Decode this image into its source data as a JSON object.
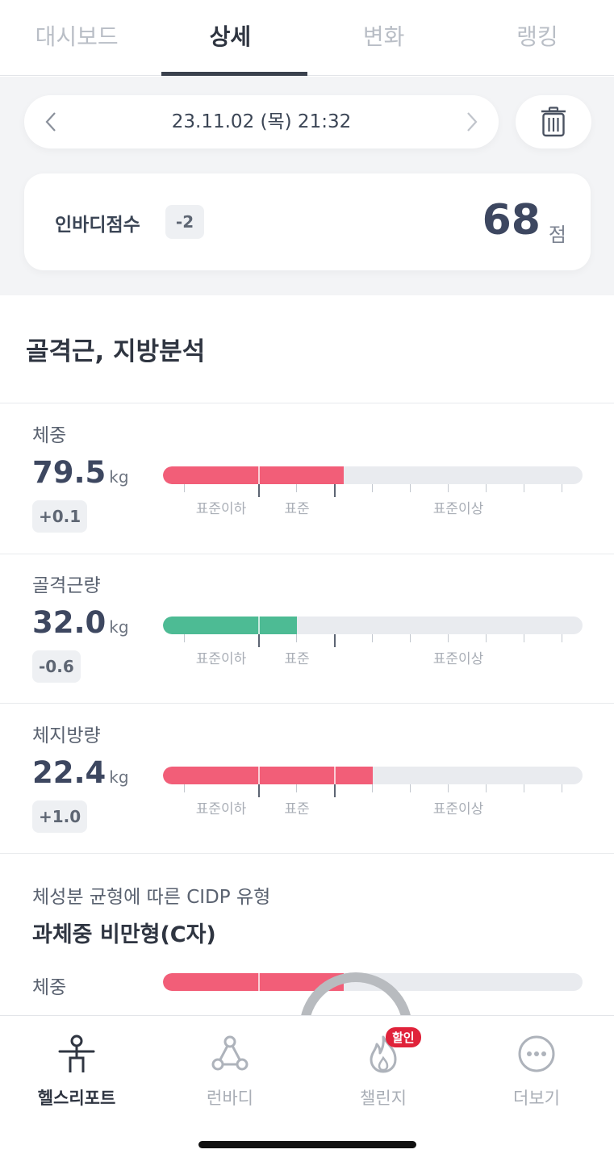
{
  "tabs": [
    {
      "label": "대시보드",
      "active": false
    },
    {
      "label": "상세",
      "active": true
    },
    {
      "label": "변화",
      "active": false
    },
    {
      "label": "랭킹",
      "active": false
    }
  ],
  "date_nav": {
    "date": "23.11.02 (목) 21:32",
    "prev_icon": "chevron-left-icon",
    "next_icon": "chevron-right-icon"
  },
  "trash_icon": "trash-icon",
  "score": {
    "label": "인바디점수",
    "change": "-2",
    "value": "68",
    "unit": "점"
  },
  "section": {
    "title": "골격근, 지방분석"
  },
  "scale_labels": {
    "below": "표준이하",
    "standard": "표준",
    "above": "표준이상"
  },
  "metrics": [
    {
      "label": "체중",
      "value": "79.5",
      "unit": "kg",
      "change": "+0.1",
      "level": 0.43,
      "color": "#f25e78"
    },
    {
      "label": "골격근량",
      "value": "32.0",
      "unit": "kg",
      "change": "-0.6",
      "level": 0.32,
      "color": "#4dbb94"
    },
    {
      "label": "체지방량",
      "value": "22.4",
      "unit": "kg",
      "change": "+1.0",
      "level": 0.5,
      "color": "#f25e78"
    }
  ],
  "cidp": {
    "subtitle": "체성분 균형에 따른 CIDP 유형",
    "type": "과체중 비만형(C자)",
    "row_label": "체중",
    "level": 0.43,
    "color": "#f25e78"
  },
  "bottom_nav": [
    {
      "label": "헬스리포트",
      "icon": "health-report-icon",
      "active": true
    },
    {
      "label": "런바디",
      "icon": "runbody-icon",
      "active": false
    },
    {
      "label": "챌린지",
      "icon": "challenge-flame-icon",
      "active": false,
      "badge": "할인"
    },
    {
      "label": "더보기",
      "icon": "more-dots-icon",
      "active": false
    }
  ]
}
